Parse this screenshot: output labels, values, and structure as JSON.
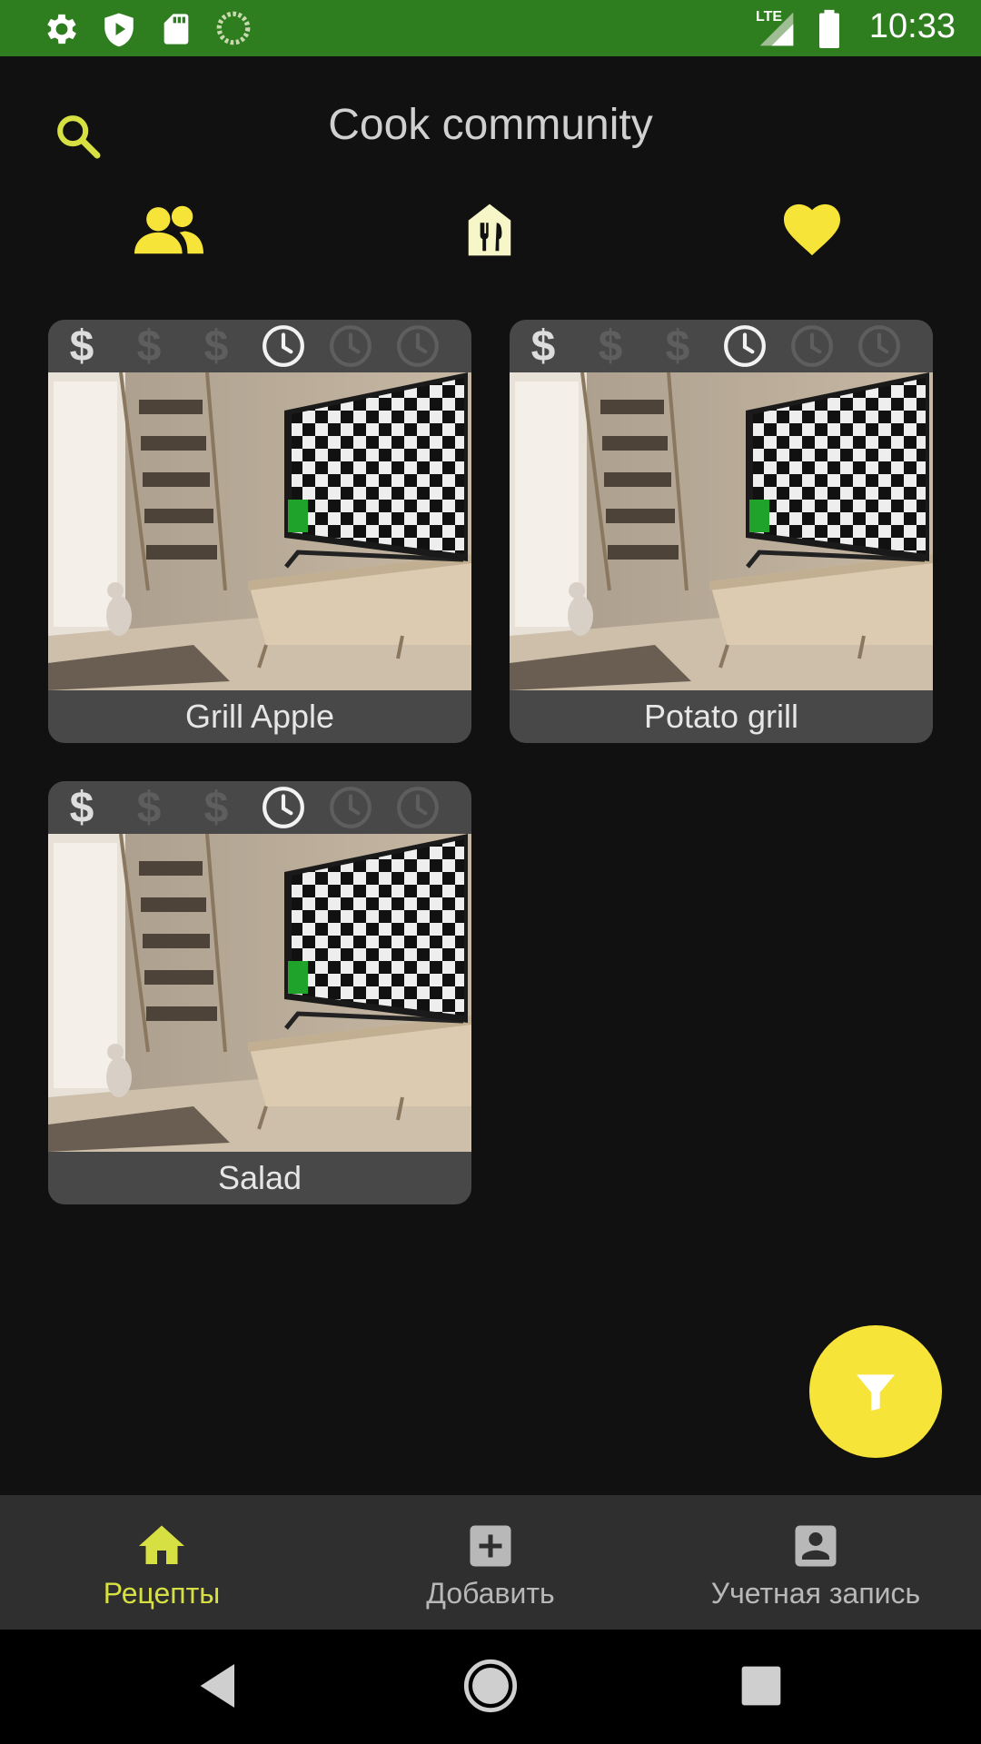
{
  "status_bar": {
    "time": "10:33",
    "network": "LTE",
    "icons": [
      "gear-icon",
      "shield-play-icon",
      "sd-card-icon",
      "sync-icon",
      "signal-icon",
      "battery-icon"
    ]
  },
  "header": {
    "title": "Cook community",
    "search_icon": "search-icon"
  },
  "tabs": [
    {
      "icon": "people-icon",
      "color": "#f7e438"
    },
    {
      "icon": "restaurant-house-icon",
      "color": "#f6f6c8"
    },
    {
      "icon": "heart-icon",
      "color": "#f7e438"
    }
  ],
  "recipes": [
    {
      "name": "Grill Apple",
      "price_level": 1,
      "price_max": 3,
      "time_level": 1,
      "time_max": 3
    },
    {
      "name": "Potato grill",
      "price_level": 1,
      "price_max": 3,
      "time_level": 1,
      "time_max": 3
    },
    {
      "name": "Salad",
      "price_level": 1,
      "price_max": 3,
      "time_level": 1,
      "time_max": 3
    }
  ],
  "price_symbol": "$",
  "fab": {
    "icon": "filter-icon",
    "color": "#f7e438"
  },
  "bottom_nav": {
    "items": [
      {
        "label": "Рецепты",
        "icon": "home-icon",
        "active": true
      },
      {
        "label": "Добавить",
        "icon": "add-box-icon",
        "active": false
      },
      {
        "label": "Учетная запись",
        "icon": "account-box-icon",
        "active": false
      }
    ]
  },
  "colors": {
    "accent": "#f7e438",
    "accent_text": "#d7e042",
    "status_bar": "#2e7d1e",
    "background": "#111111",
    "card": "#484848"
  }
}
